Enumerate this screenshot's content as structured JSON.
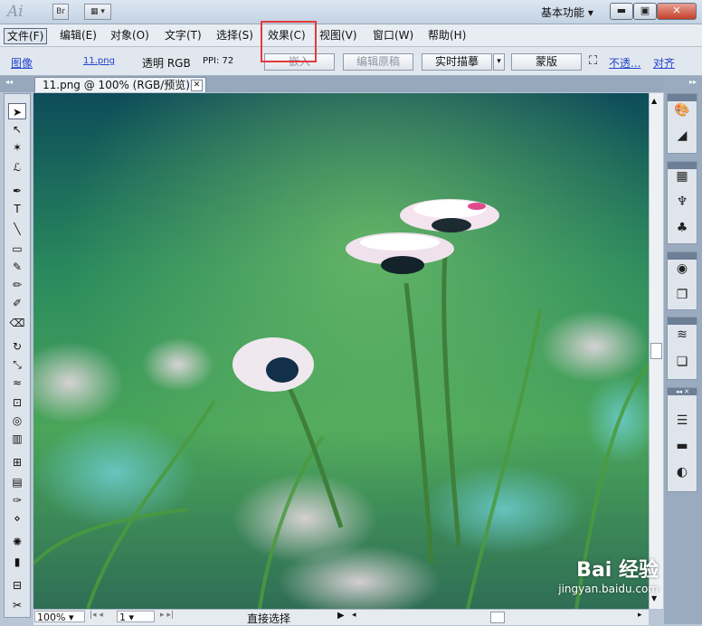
{
  "app": {
    "logo": "Ai",
    "bridge_label": "Br",
    "workspace": "基本功能"
  },
  "window_buttons": {
    "minimize": "▬",
    "maximize": "▣",
    "close": "✕"
  },
  "menus": [
    "文件(F)",
    "编辑(E)",
    "对象(O)",
    "文字(T)",
    "选择(S)",
    "效果(C)",
    "视图(V)",
    "窗口(W)",
    "帮助(H)"
  ],
  "control_bar": {
    "image_label": "图像",
    "file_link": "11.png",
    "color_mode": "透明 RGB",
    "ppi": "PPI: 72",
    "embed_button": "嵌入",
    "edit_original_button": "编辑原稿",
    "live_trace_button": "实时描摹",
    "mask_button": "蒙版",
    "opacity_link": "不透...",
    "align_link": "对齐"
  },
  "document_tab": {
    "title": "11.png @ 100% (RGB/预览)",
    "close": "✕"
  },
  "status_bar": {
    "zoom": "100%",
    "artboard": "1",
    "tool_status": "直接选择"
  },
  "tools": [
    {
      "name": "selection-tool",
      "glyph": "➤"
    },
    {
      "name": "direct-selection-tool",
      "glyph": "↖"
    },
    {
      "name": "magic-wand-tool",
      "glyph": "✶"
    },
    {
      "name": "lasso-tool",
      "glyph": "ℒ"
    },
    {
      "name": "pen-tool",
      "glyph": "✒"
    },
    {
      "name": "type-tool",
      "glyph": "T"
    },
    {
      "name": "line-tool",
      "glyph": "╲"
    },
    {
      "name": "rectangle-tool",
      "glyph": "▭"
    },
    {
      "name": "paintbrush-tool",
      "glyph": "✎"
    },
    {
      "name": "pencil-tool",
      "glyph": "✏"
    },
    {
      "name": "blob-brush-tool",
      "glyph": "✐"
    },
    {
      "name": "eraser-tool",
      "glyph": "⌫"
    },
    {
      "name": "rotate-tool",
      "glyph": "↻"
    },
    {
      "name": "scale-tool",
      "glyph": "⤡"
    },
    {
      "name": "warp-tool",
      "glyph": "≈"
    },
    {
      "name": "free-transform-tool",
      "glyph": "⊡"
    },
    {
      "name": "shape-builder-tool",
      "glyph": "◎"
    },
    {
      "name": "graph-tool",
      "glyph": "▥"
    },
    {
      "name": "mesh-tool",
      "glyph": "⊞"
    },
    {
      "name": "gradient-tool",
      "glyph": "▤"
    },
    {
      "name": "eyedropper-tool",
      "glyph": "✑"
    },
    {
      "name": "blend-tool",
      "glyph": "⋄"
    },
    {
      "name": "symbol-sprayer-tool",
      "glyph": "✺"
    },
    {
      "name": "column-graph-tool",
      "glyph": "▮"
    },
    {
      "name": "artboard-tool",
      "glyph": "⊟"
    },
    {
      "name": "slice-tool",
      "glyph": "✂"
    }
  ],
  "right_icons": [
    {
      "name": "color-panel-icon",
      "glyph": "🎨"
    },
    {
      "name": "color-guide-icon",
      "glyph": "◢"
    },
    {
      "name": "swatches-icon",
      "glyph": "▦"
    },
    {
      "name": "brushes-icon",
      "glyph": "♆"
    },
    {
      "name": "symbols-icon",
      "glyph": "♣"
    },
    {
      "name": "graphic-styles-icon",
      "glyph": "◉"
    },
    {
      "name": "appearance-icon",
      "glyph": "❐"
    },
    {
      "name": "layers-icon",
      "glyph": "≋"
    },
    {
      "name": "artboards-icon",
      "glyph": "❏"
    },
    {
      "name": "stroke-icon",
      "glyph": "☰"
    },
    {
      "name": "gradient-icon",
      "glyph": "▬"
    },
    {
      "name": "transparency-icon",
      "glyph": "◐"
    }
  ],
  "watermark": {
    "brand": "Bai 经验",
    "url": "jingyan.baidu.com"
  }
}
